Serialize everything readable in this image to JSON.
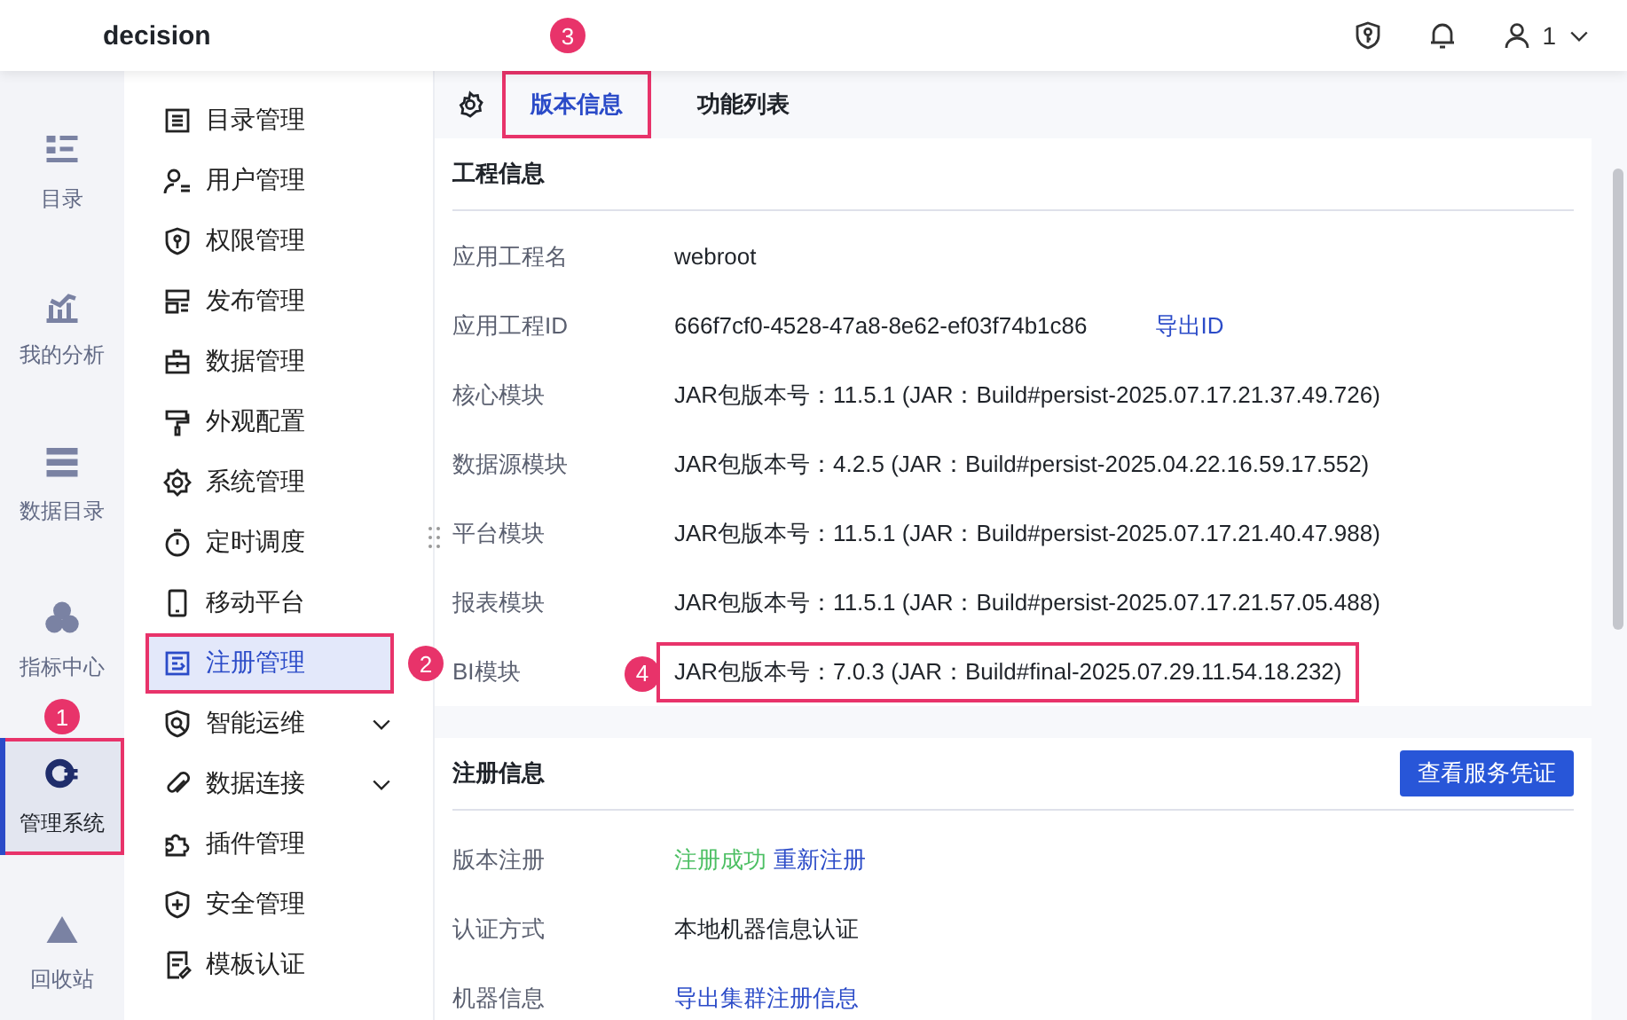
{
  "app": {
    "title": "decision"
  },
  "header": {
    "user": "1"
  },
  "nav": [
    {
      "label": "目录",
      "selected": false
    },
    {
      "label": "我的分析",
      "selected": false
    },
    {
      "label": "数据目录",
      "selected": false
    },
    {
      "label": "指标中心",
      "selected": false
    },
    {
      "label": "管理系统",
      "selected": true,
      "callout": "1"
    },
    {
      "label": "回收站",
      "selected": false
    }
  ],
  "submenu": [
    {
      "label": "目录管理",
      "kind": "item",
      "selected": false
    },
    {
      "label": "用户管理",
      "kind": "item",
      "selected": false
    },
    {
      "label": "权限管理",
      "kind": "item",
      "selected": false
    },
    {
      "label": "发布管理",
      "kind": "item",
      "selected": false
    },
    {
      "label": "数据管理",
      "kind": "item",
      "selected": false
    },
    {
      "label": "外观配置",
      "kind": "item",
      "selected": false
    },
    {
      "label": "系统管理",
      "kind": "item",
      "selected": false
    },
    {
      "label": "定时调度",
      "kind": "item",
      "selected": false
    },
    {
      "label": "移动平台",
      "kind": "item",
      "selected": false
    },
    {
      "label": "注册管理",
      "kind": "item",
      "selected": true,
      "callout": "2"
    },
    {
      "label": "智能运维",
      "kind": "group",
      "selected": false
    },
    {
      "label": "数据连接",
      "kind": "group",
      "selected": false
    },
    {
      "label": "插件管理",
      "kind": "item",
      "selected": false
    },
    {
      "label": "安全管理",
      "kind": "item",
      "selected": false
    },
    {
      "label": "模板认证",
      "kind": "item",
      "selected": false
    }
  ],
  "tabs": [
    {
      "label": "版本信息",
      "selected": true,
      "callout": "3"
    },
    {
      "label": "功能列表",
      "selected": false
    }
  ],
  "project_info": {
    "title": "工程信息",
    "rows": [
      {
        "label": "应用工程名",
        "value": "webroot"
      },
      {
        "label": "应用工程ID",
        "value": "666f7cf0-4528-47a8-8e62-ef03f74b1c86",
        "link": "导出ID"
      },
      {
        "label": "核心模块",
        "value": "JAR包版本号：11.5.1 (JAR：Build#persist-2025.07.17.21.37.49.726)"
      },
      {
        "label": "数据源模块",
        "value": "JAR包版本号：4.2.5 (JAR：Build#persist-2025.04.22.16.59.17.552)"
      },
      {
        "label": "平台模块",
        "value": "JAR包版本号：11.5.1 (JAR：Build#persist-2025.07.17.21.40.47.988)"
      },
      {
        "label": "报表模块",
        "value": "JAR包版本号：11.5.1 (JAR：Build#persist-2025.07.17.21.57.05.488)"
      },
      {
        "label": "BI模块",
        "value": "JAR包版本号：7.0.3 (JAR：Build#final-2025.07.29.11.54.18.232)",
        "callout": "4"
      }
    ]
  },
  "registration_info": {
    "title": "注册信息",
    "button": "查看服务凭证",
    "rows": [
      {
        "label": "版本注册",
        "status": "注册成功",
        "link": "重新注册"
      },
      {
        "label": "认证方式",
        "value": "本地机器信息认证"
      },
      {
        "label": "机器信息",
        "link": "导出集群注册信息"
      }
    ]
  }
}
